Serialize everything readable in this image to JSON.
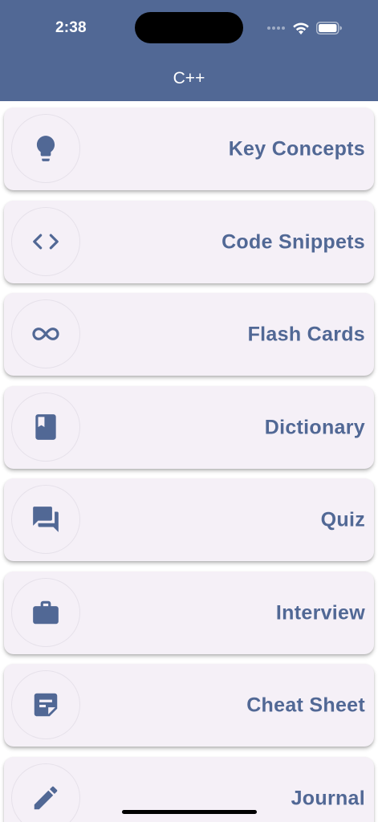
{
  "status_bar": {
    "time": "2:38"
  },
  "header": {
    "title": "C++"
  },
  "menu": {
    "items": [
      {
        "label": "Key Concepts",
        "icon": "lightbulb-icon"
      },
      {
        "label": "Code Snippets",
        "icon": "code-icon"
      },
      {
        "label": "Flash Cards",
        "icon": "infinity-icon"
      },
      {
        "label": "Dictionary",
        "icon": "book-icon"
      },
      {
        "label": "Quiz",
        "icon": "forum-icon"
      },
      {
        "label": "Interview",
        "icon": "briefcase-icon"
      },
      {
        "label": "Cheat Sheet",
        "icon": "note-icon"
      },
      {
        "label": "Journal",
        "icon": "pencil-icon"
      }
    ]
  },
  "colors": {
    "header_bg": "#516895",
    "card_bg": "#f5f0f7",
    "accent": "#516895"
  }
}
